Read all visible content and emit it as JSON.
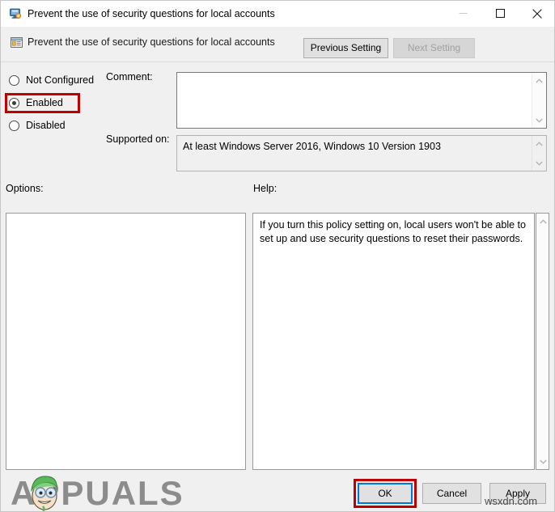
{
  "window": {
    "title": "Prevent the use of security questions for local accounts",
    "title_icon": "policy-monitor-icon",
    "minimize_label": "—",
    "maximize_label": "□",
    "close_label": "✕"
  },
  "header": {
    "icon": "policy-setting-icon",
    "title": "Prevent the use of security questions for local accounts",
    "previous_setting_label": "Previous Setting",
    "next_setting_label": "Next Setting",
    "next_setting_disabled": true
  },
  "state_options": {
    "selected": "Enabled",
    "items": [
      {
        "label": "Not Configured",
        "checked": false
      },
      {
        "label": "Enabled",
        "checked": true
      },
      {
        "label": "Disabled",
        "checked": false
      }
    ]
  },
  "comment": {
    "label": "Comment:",
    "value": "",
    "scroll_up_glyph": "⌃",
    "scroll_down_glyph": "⌄"
  },
  "supported_on": {
    "label": "Supported on:",
    "value": "At least Windows Server 2016, Windows 10 Version 1903",
    "scroll_up_glyph": "⌃",
    "scroll_down_glyph": "⌄"
  },
  "options_panel": {
    "label": "Options:",
    "value": ""
  },
  "help_panel": {
    "label": "Help:",
    "value": "If you turn this policy setting on, local users won't be able to set up and use security questions to reset their passwords.",
    "scroll_up_glyph": "⌃",
    "scroll_down_glyph": "⌄"
  },
  "footer": {
    "ok_label": "OK",
    "cancel_label": "Cancel",
    "apply_label": "Apply"
  },
  "annotations": {
    "highlight_color": "#c00000",
    "focus_color": "#0078d7",
    "targets": [
      "enabled-radio",
      "ok-button"
    ]
  },
  "watermarks": {
    "brand": "APPUALS",
    "site": "wsxdn.com"
  }
}
